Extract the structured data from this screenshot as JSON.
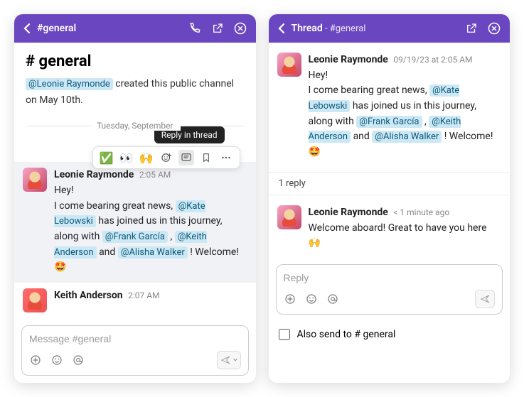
{
  "left": {
    "header": {
      "title": "#general"
    },
    "channel_heading": "# general",
    "creator_mention": "@Leonie Raymonde",
    "creator_suffix": "  created this public channel on May 10th.",
    "date_divider": "Tuesday, September",
    "tooltip": "Reply in thread",
    "reactions": {
      "r1": "✅",
      "r2": "👀",
      "r3": "🙌"
    },
    "msg1": {
      "author": "Leonie Raymonde",
      "time": "2:05 AM",
      "line1": "Hey!",
      "line2a": "I come bearing great news,",
      "m1": "@Kate Lebowski",
      "line2b": "  has joined us in this journey, along with ",
      "m2": "@Frank García",
      "sep1": " , ",
      "m3": "@Keith Anderson",
      "sep2": "   and ",
      "m4": "@Alisha Walker",
      "tail": " ! Welcome! ",
      "emoji": "🤩"
    },
    "msg2": {
      "author": "Keith Anderson",
      "time": "2:07 AM"
    },
    "composer_placeholder": "Message #general"
  },
  "right": {
    "header": {
      "title": "Thread",
      "sub": " - #general"
    },
    "msg1": {
      "author": "Leonie Raymonde",
      "time": "09/19/23 at 2:05 AM",
      "line1": "Hey!",
      "line2a": "I come bearing great news,",
      "m1": "@Kate Lebowski",
      "line2b": "  has joined us in this journey, along with",
      "m2": "@Frank García",
      "sep1": " , ",
      "m3": "@Keith Anderson",
      "sep2": " and ",
      "m4": "@Alisha Walker",
      "tail": " ! Welcome! ",
      "emoji": "🤩"
    },
    "reply_count": "1 reply",
    "msg2": {
      "author": "Leonie Raymonde",
      "time": "< 1 minute ago",
      "text": "Welcome aboard! Great to have you here ",
      "emoji": "🙌"
    },
    "composer_placeholder": "Reply",
    "also_send": "Also send to # general"
  }
}
